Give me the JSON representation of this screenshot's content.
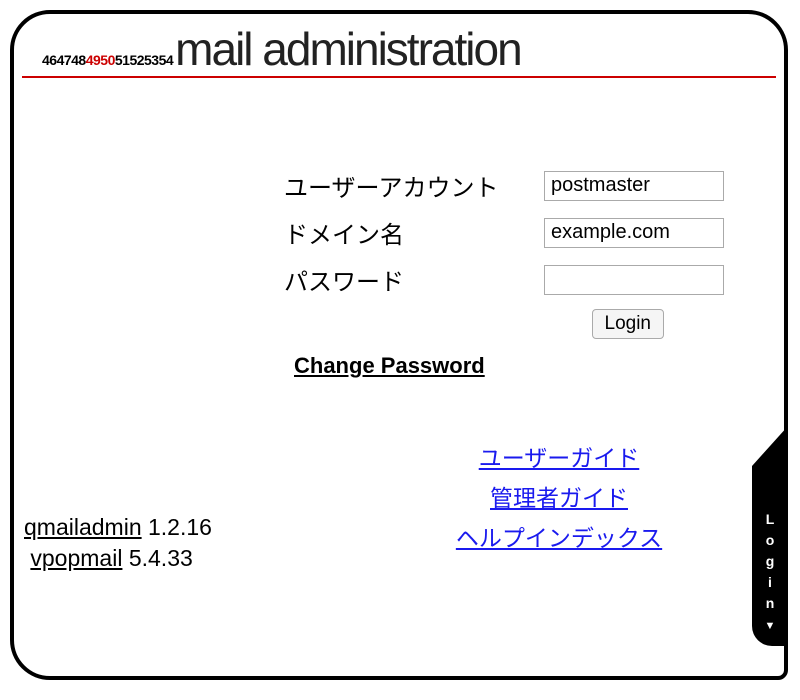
{
  "header": {
    "logo_prefix": "464748",
    "logo_red": "4950",
    "logo_suffix": "51525354",
    "title": "mail administration"
  },
  "form": {
    "user_label": "ユーザーアカウント",
    "user_value": "postmaster",
    "domain_label": "ドメイン名",
    "domain_value": "example.com",
    "password_label": "パスワード",
    "password_value": "",
    "login_button": "Login",
    "change_password": "Change Password"
  },
  "links": {
    "user_guide": "ユーザーガイド",
    "admin_guide": "管理者ガイド",
    "help_index": "ヘルプインデックス"
  },
  "footer": {
    "qmailadmin_name": "qmailadmin",
    "qmailadmin_version": "1.2.16",
    "vpopmail_name": "vpopmail",
    "vpopmail_version": "5.4.33"
  },
  "side_tab": {
    "label": "Login"
  }
}
